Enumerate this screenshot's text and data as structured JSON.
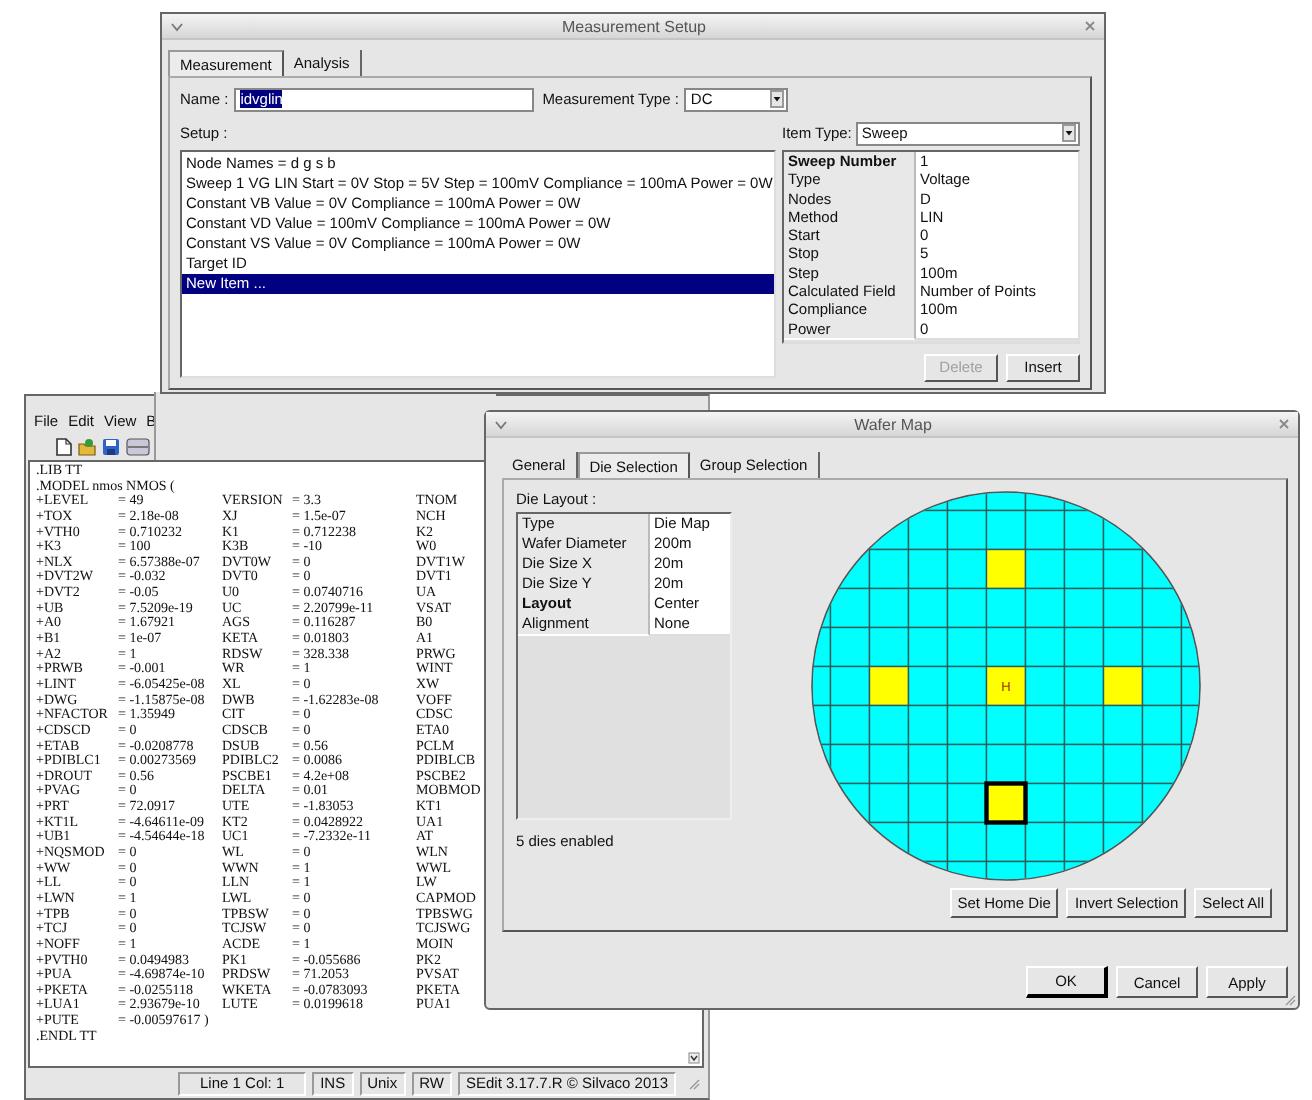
{
  "measurement_setup": {
    "title": "Measurement Setup",
    "tabs": [
      {
        "label": "Measurement",
        "selected": true
      },
      {
        "label": "Analysis",
        "selected": false
      }
    ],
    "name": {
      "label": "Name :",
      "value": "idvglin",
      "text_selected": true
    },
    "measurement_type": {
      "label": "Measurement Type :",
      "value": "DC"
    },
    "setup_label": "Setup :",
    "setup_items": [
      {
        "text": "Node Names = d g s b",
        "selected": false
      },
      {
        "text": "Sweep 1 VG LIN Start = 0V Stop = 5V Step = 100mV Compliance = 100mA Power = 0W",
        "selected": false
      },
      {
        "text": "Constant VB Value = 0V Compliance = 100mA Power = 0W",
        "selected": false
      },
      {
        "text": "Constant VD Value = 100mV Compliance = 100mA Power = 0W",
        "selected": false
      },
      {
        "text": "Constant VS Value = 0V Compliance = 100mA Power = 0W",
        "selected": false
      },
      {
        "text": "Target ID",
        "selected": false
      },
      {
        "text": "New Item ...",
        "selected": true
      }
    ],
    "item_type": {
      "label": "Item Type:",
      "value": "Sweep"
    },
    "properties": [
      {
        "key": "Sweep Number",
        "value": "1",
        "selected": true
      },
      {
        "key": "Type",
        "value": "Voltage",
        "selected": false
      },
      {
        "key": "Nodes",
        "value": "D",
        "selected": false
      },
      {
        "key": "Method",
        "value": "LIN",
        "selected": false
      },
      {
        "key": "Start",
        "value": "0",
        "selected": false
      },
      {
        "key": "Stop",
        "value": "5",
        "selected": false
      },
      {
        "key": "Step",
        "value": "100m",
        "selected": false
      },
      {
        "key": "Calculated Field",
        "value": "Number of Points",
        "selected": false
      },
      {
        "key": "Compliance",
        "value": "100m",
        "selected": false
      },
      {
        "key": "Power",
        "value": "0",
        "selected": false
      }
    ],
    "buttons": [
      {
        "label": "Delete",
        "disabled": true
      },
      {
        "label": "Insert",
        "disabled": false
      }
    ]
  },
  "editor": {
    "menu": [
      "File",
      "Edit",
      "View",
      "B"
    ],
    "lines": [
      [
        ".LIB TT"
      ],
      [
        ".MODEL nmos NMOS ("
      ],
      [
        "+LEVEL",
        "= 49",
        "VERSION",
        "= 3.3",
        "TNOM"
      ],
      [
        "+TOX",
        "= 2.18e-08",
        "XJ",
        "= 1.5e-07",
        "NCH"
      ],
      [
        "+VTH0",
        "= 0.710232",
        "K1",
        "= 0.712238",
        "K2"
      ],
      [
        "+K3",
        "= 100",
        "K3B",
        "= -10",
        "W0"
      ],
      [
        "+NLX",
        "= 6.57388e-07",
        "DVT0W",
        "= 0",
        "DVT1W"
      ],
      [
        "+DVT2W",
        "= -0.032",
        "DVT0",
        "= 0",
        "DVT1"
      ],
      [
        "+DVT2",
        "= -0.05",
        "U0",
        "= 0.0740716",
        "UA"
      ],
      [
        "+UB",
        "= 7.5209e-19",
        "UC",
        "= 2.20799e-11",
        "VSAT"
      ],
      [
        "+A0",
        "= 1.67921",
        "AGS",
        "= 0.116287",
        "B0"
      ],
      [
        "+B1",
        "= 1e-07",
        "KETA",
        "= 0.01803",
        "A1"
      ],
      [
        "+A2",
        "= 1",
        "RDSW",
        "= 328.338",
        "PRWG"
      ],
      [
        "+PRWB",
        "= -0.001",
        "WR",
        "= 1",
        "WINT"
      ],
      [
        "+LINT",
        "= -6.05425e-08",
        "XL",
        "= 0",
        "XW"
      ],
      [
        "+DWG",
        "= -1.15875e-08",
        "DWB",
        "= -1.62283e-08",
        "VOFF"
      ],
      [
        "+NFACTOR",
        "= 1.35949",
        "CIT",
        "= 0",
        "CDSC"
      ],
      [
        "+CDSCD",
        "= 0",
        "CDSCB",
        "= 0",
        "ETA0"
      ],
      [
        "+ETAB",
        "= -0.0208778",
        "DSUB",
        "= 0.56",
        "PCLM"
      ],
      [
        "+PDIBLC1",
        "= 0.00273569",
        "PDIBLC2",
        "= 0.0086",
        "PDIBLCB"
      ],
      [
        "+DROUT",
        "= 0.56",
        "PSCBE1",
        "= 4.2e+08",
        "PSCBE2"
      ],
      [
        "+PVAG",
        "= 0",
        "DELTA",
        "= 0.01",
        "MOBMOD"
      ],
      [
        "+PRT",
        "= 72.0917",
        "UTE",
        "= -1.83053",
        "KT1"
      ],
      [
        "+KT1L",
        "= -4.64611e-09",
        "KT2",
        "= 0.0428922",
        "UA1"
      ],
      [
        "+UB1",
        "= -4.54644e-18",
        "UC1",
        "= -7.2332e-11",
        "AT"
      ],
      [
        "+NQSMOD",
        "= 0",
        "WL",
        "= 0",
        "WLN"
      ],
      [
        "+WW",
        "= 0",
        "WWN",
        "= 1",
        "WWL"
      ],
      [
        "+LL",
        "= 0",
        "LLN",
        "= 1",
        "LW"
      ],
      [
        "+LWN",
        "= 1",
        "LWL",
        "= 0",
        "CAPMOD"
      ],
      [
        "+TPB",
        "= 0",
        "TPBSW",
        "= 0",
        "TPBSWG"
      ],
      [
        "+TCJ",
        "= 0",
        "TCJSW",
        "= 0",
        "TCJSWG"
      ],
      [
        "+NOFF",
        "= 1",
        "ACDE",
        "= 1",
        "MOIN"
      ],
      [
        "+PVTH0",
        "= 0.0494983",
        "PK1",
        "= -0.055686",
        "PK2"
      ],
      [
        "+PUA",
        "= -4.69874e-10",
        "PRDSW",
        "= 71.2053",
        "PVSAT"
      ],
      [
        "+PKETA",
        "= -0.0255118",
        "WKETA",
        "= -0.0783093",
        "PKETA"
      ],
      [
        "+LUA1",
        "= 2.93679e-10",
        "LUTE",
        "= 0.0199618",
        "PUA1"
      ],
      [
        "+PUTE",
        "= -0.00597617 )"
      ],
      [
        ".ENDL TT"
      ]
    ],
    "status_bar": [
      "Line 1 Col: 1",
      "INS",
      "Unix",
      "RW",
      "SEdit 3.17.7.R © Silvaco 2013"
    ]
  },
  "wafer_map": {
    "title": "Wafer Map",
    "tabs": [
      {
        "label": "General",
        "selected": false
      },
      {
        "label": "Die Selection",
        "selected": true
      },
      {
        "label": "Group Selection",
        "selected": false
      }
    ],
    "die_layout_label": "Die Layout :",
    "properties": [
      {
        "key": "Type",
        "value": "Die Map",
        "selected": false
      },
      {
        "key": "Wafer Diameter",
        "value": "200m",
        "selected": false
      },
      {
        "key": "Die Size X",
        "value": "20m",
        "selected": false
      },
      {
        "key": "Die Size Y",
        "value": "20m",
        "selected": false
      },
      {
        "key": "Layout",
        "value": "Center",
        "selected": true
      },
      {
        "key": "Alignment",
        "value": "None",
        "selected": false
      }
    ],
    "status": "5 dies enabled",
    "die_rows": [
      {
        "enabled": [
          false,
          false,
          false,
          false,
          false
        ],
        "selected": [
          false,
          false,
          false,
          false,
          false
        ]
      },
      {
        "enabled": [
          false,
          false,
          false,
          false,
          false,
          false,
          false
        ],
        "selected": [
          false,
          false,
          false,
          false,
          false,
          false,
          false
        ]
      },
      {
        "enabled": [
          false,
          false,
          false,
          false,
          true,
          false,
          false,
          false,
          false
        ],
        "selected": [
          false,
          false,
          false,
          false,
          false,
          false,
          false,
          false,
          false
        ]
      },
      {
        "enabled": [
          false,
          false,
          false,
          false,
          false,
          false,
          false,
          false,
          false,
          false,
          false
        ],
        "selected": [
          false,
          false,
          false,
          false,
          false,
          false,
          false,
          false,
          false,
          false,
          false
        ]
      },
      {
        "enabled": [
          false,
          false,
          false,
          false,
          false,
          false,
          false,
          false,
          false,
          false,
          false
        ],
        "selected": [
          false,
          false,
          false,
          false,
          false,
          false,
          false,
          false,
          false,
          false,
          false
        ]
      },
      {
        "enabled": [
          false,
          false,
          true,
          false,
          false,
          true,
          false,
          false,
          true,
          false,
          false
        ],
        "selected": [
          false,
          false,
          false,
          false,
          false,
          false,
          false,
          false,
          false,
          false,
          false
        ]
      },
      {
        "enabled": [
          false,
          false,
          false,
          false,
          false,
          false,
          false,
          false,
          false,
          false,
          false
        ],
        "selected": [
          false,
          false,
          false,
          false,
          false,
          false,
          false,
          false,
          false,
          false,
          false
        ]
      },
      {
        "enabled": [
          false,
          false,
          false,
          false,
          false,
          false,
          false,
          false,
          false,
          false,
          false
        ],
        "selected": [
          false,
          false,
          false,
          false,
          false,
          false,
          false,
          false,
          false,
          false,
          false
        ]
      },
      {
        "enabled": [
          false,
          false,
          false,
          false,
          true,
          false,
          false,
          false,
          false
        ],
        "selected": [
          false,
          false,
          false,
          false,
          true,
          false,
          false,
          false,
          false
        ]
      },
      {
        "enabled": [
          false,
          false,
          false,
          false,
          false,
          false,
          false
        ],
        "selected": [
          false,
          false,
          false,
          false,
          false,
          false,
          false
        ]
      },
      {
        "enabled": [
          false,
          false,
          false,
          false,
          false
        ],
        "selected": [
          false,
          false,
          false,
          false,
          false
        ]
      }
    ],
    "home_die_label": "H",
    "actions": [
      {
        "label": "Set Home Die"
      },
      {
        "label": "Invert Selection"
      },
      {
        "label": "Select All"
      }
    ],
    "buttons": [
      {
        "label": "OK",
        "default": true
      },
      {
        "label": "Cancel",
        "default": false
      },
      {
        "label": "Apply",
        "default": false
      }
    ]
  }
}
